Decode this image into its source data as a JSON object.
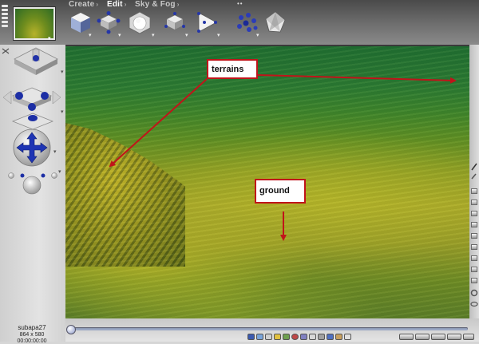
{
  "menu": {
    "tabs": [
      {
        "label": "Create",
        "chevron": "›"
      },
      {
        "label": "Edit",
        "chevron": "›"
      },
      {
        "label": "Sky & Fog",
        "chevron": "›"
      }
    ],
    "active_tab": "Edit"
  },
  "toolbar": {
    "tools": [
      "cube-icon",
      "move-gizmo-icon",
      "sphere-in-cube-icon",
      "rotate-gizmo-icon",
      "play-arrow-icon",
      "molecule-icon",
      "crystal-icon"
    ],
    "caret": "▾",
    "grip": "••"
  },
  "document": {
    "name": "subapa27",
    "size": "864 x 580",
    "time": "00:00:00:00"
  },
  "annotations": {
    "terrains_label": "terrains",
    "ground_label": "ground",
    "arrow_color": "#c0141a"
  },
  "colors": {
    "toolbar_dark": "#4a4a4a",
    "panel": "#d6d6d6",
    "sky_green": "#1f6e31",
    "ground_yellow": "#a9a92a"
  }
}
